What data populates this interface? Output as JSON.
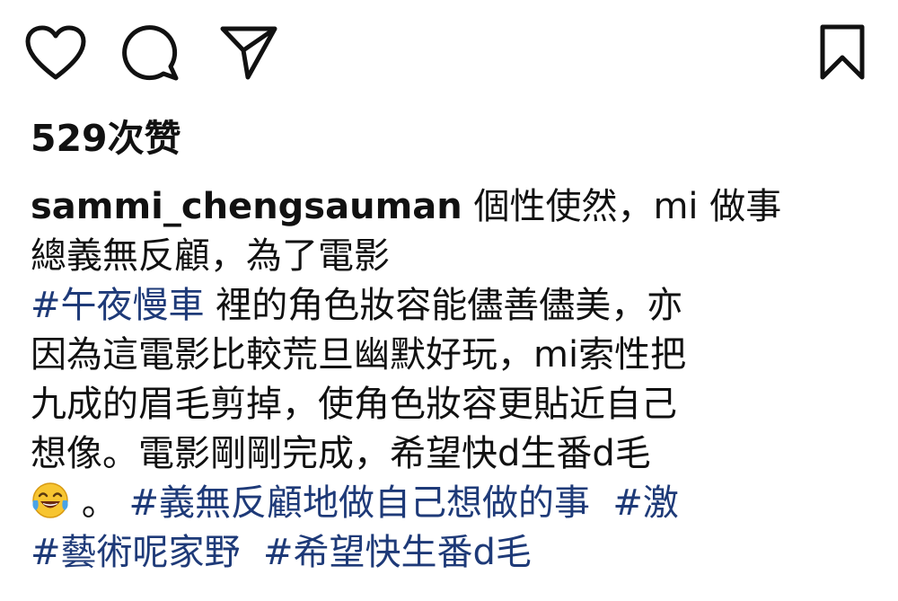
{
  "actions": {
    "like": "heart-icon",
    "comment": "comment-bubble-icon",
    "share": "paper-plane-icon",
    "save": "bookmark-icon"
  },
  "likes": {
    "text": "529次赞"
  },
  "caption": {
    "username": "sammi_chengsauman",
    "line1_text": " 個性使然，mi 做事",
    "line2_text": "總義無反顧，為了電影",
    "line3_hashtag": "#午夜慢車",
    "line3_text": "  裡的角色妝容能儘善儘美，亦",
    "line4_text": "因為這電影比較荒旦幽默好玩，mi索性把",
    "line5_text": "九成的眉毛剪掉，使角色妝容更貼近自己",
    "line6_text": "想像。電影剛剛完成，希望快d生番d毛",
    "line7_emoji": "laughing-tears-emoji",
    "line7_text": "  。  ",
    "line7_hashtag1": "#義無反顧地做自己想做的事",
    "line7_hashtag2": "#激",
    "line8_hashtag1": "#藝術呢家野",
    "line8_hashtag2": "#希望快生番d毛"
  },
  "colors": {
    "text": "#111111",
    "hashtag": "#1e3a78",
    "background": "#ffffff"
  }
}
